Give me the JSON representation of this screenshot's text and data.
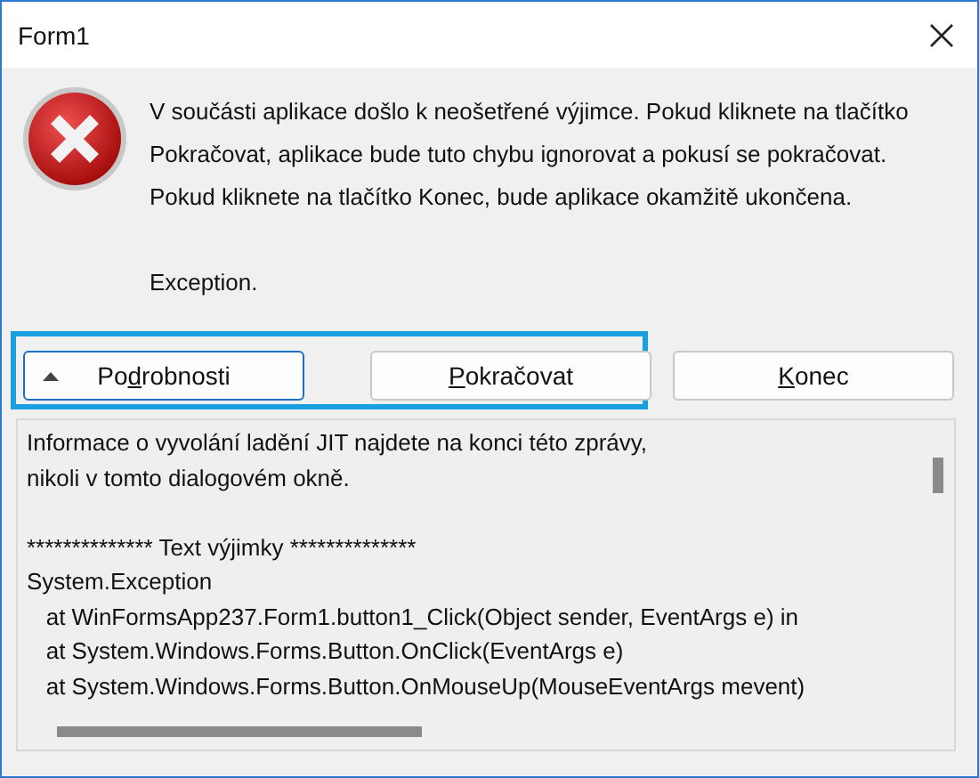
{
  "window": {
    "title": "Form1"
  },
  "message": {
    "paragraphs": [
      "V součásti aplikace došlo k neošetřené výjimce. Pokud kliknete na tlačítko Pokračovat, aplikace bude tuto chybu ignorovat a pokusí se pokračovat. Pokud kliknete na tlačítko Konec, bude aplikace okamžitě ukončena.",
      "Exception."
    ]
  },
  "buttons": [
    {
      "kind": "toggle",
      "before": "Po",
      "mnemonic": "d",
      "after": "robnosti",
      "highlighted": true
    },
    {
      "kind": "plain",
      "mnemonic": "P",
      "after": "okračovat",
      "highlighted": true
    },
    {
      "kind": "plain",
      "mnemonic": "K",
      "after": "onec",
      "highlighted": false
    }
  ],
  "details": {
    "blocks": [
      [
        "Informace o vyvolání ladění JIT najdete na konci této zprávy,",
        "nikoli v tomto dialogovém okně."
      ],
      [
        "************** Text výjimky **************",
        "System.Exception",
        "   at WinFormsApp237.Form1.button1_Click(Object sender, EventArgs e) in",
        "   at System.Windows.Forms.Button.OnClick(EventArgs e)",
        "   at System.Windows.Forms.Button.OnMouseUp(MouseEventArgs mevent)"
      ]
    ]
  }
}
